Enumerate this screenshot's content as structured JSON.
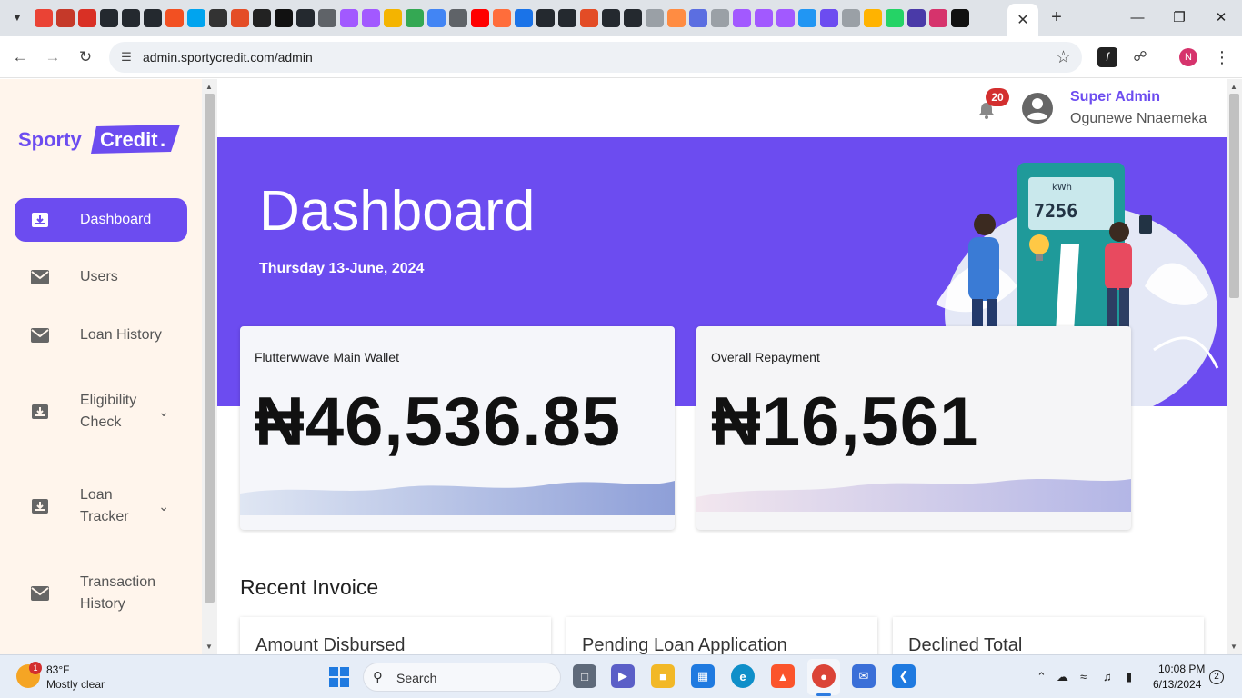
{
  "browser": {
    "url": "admin.sportycredit.com/admin",
    "profile_initial": "N",
    "favicon_colors": [
      "#ea4335",
      "#c53929",
      "#d93025",
      "#24292f",
      "#24292f",
      "#24292f",
      "#f25022",
      "#00a4ef",
      "#333333",
      "#e44d26",
      "#222222",
      "#111111",
      "#24292f",
      "#5f6368",
      "#a259ff",
      "#a259ff",
      "#f4b400",
      "#34a853",
      "#4285f4",
      "#5f6368",
      "#ff0000",
      "#ff6d3b",
      "#1a73e8",
      "#24292f",
      "#24292f",
      "#e34c26",
      "#24292f",
      "#24292f",
      "#9aa0a6",
      "#ff8c42",
      "#5b6ee1",
      "#9aa0a6",
      "#a259ff",
      "#a259ff",
      "#a259ff",
      "#2196f3",
      "#6c4cf0",
      "#9aa0a6",
      "#ffb300",
      "#25d366",
      "#4a3aa8",
      "#d6336c",
      "#111111"
    ]
  },
  "sidebar": {
    "brand_left": "Sporty",
    "brand_right": "Credit",
    "brand_dot": ".",
    "items": [
      {
        "label": "Dashboard",
        "icon": "inbox-download-icon",
        "active": true
      },
      {
        "label": "Users",
        "icon": "mail-icon"
      },
      {
        "label": "Loan History",
        "icon": "mail-icon"
      },
      {
        "label": "Eligibility Check",
        "icon": "inbox-download-icon",
        "expandable": true
      },
      {
        "label": "Loan Tracker",
        "icon": "inbox-download-icon",
        "expandable": true
      },
      {
        "label": "Transaction History",
        "icon": "mail-icon"
      }
    ]
  },
  "header": {
    "notification_count": "20",
    "role": "Super Admin",
    "user_name": "Ogunewe Nnaemeka"
  },
  "hero": {
    "title": "Dashboard",
    "date": "Thursday 13-June, 2024",
    "illustration_text": "kWh",
    "illustration_digits": "7256"
  },
  "cards": [
    {
      "title": "Flutterwwave Main Wallet",
      "value": "₦46,536.85"
    },
    {
      "title": "Overall Repayment",
      "value": "₦16,561"
    }
  ],
  "recent": {
    "heading": "Recent Invoice",
    "cards": [
      "Amount Disbursed",
      "Pending Loan Application",
      "Declined Total"
    ]
  },
  "taskbar": {
    "weather_badge": "1",
    "temperature": "83°F",
    "condition": "Mostly clear",
    "search_label": "Search",
    "time": "10:08 PM",
    "date": "6/13/2024",
    "notification_count": "2"
  },
  "colors": {
    "accent": "#6c4cf0",
    "sidebar_bg": "#fff5ec",
    "badge": "#d32f2f"
  }
}
